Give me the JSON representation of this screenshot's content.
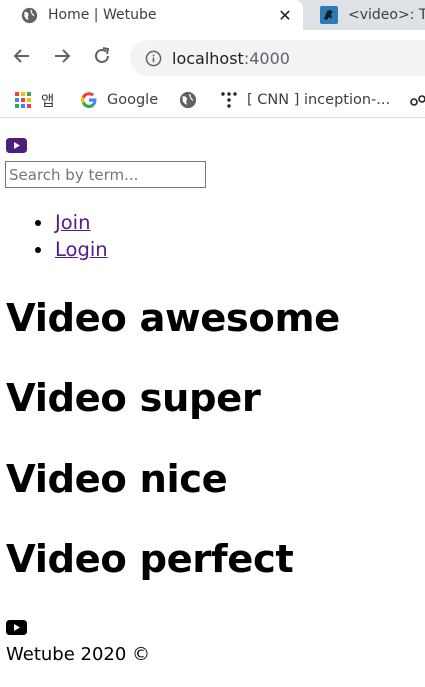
{
  "browser": {
    "tabs": [
      {
        "title": "Home | Wetube",
        "favicon": "globe-icon",
        "active": true,
        "close": "✕"
      },
      {
        "title": "<video>: Th",
        "favicon": "mdn-dino-icon",
        "active": false
      }
    ],
    "address": {
      "host": "localhost",
      "port": ":4000"
    },
    "bookmarks": [
      {
        "label": "앱",
        "icon": "apps-grid-icon"
      },
      {
        "label": "Google",
        "icon": "google-icon"
      },
      {
        "label": "",
        "icon": "globe-icon"
      },
      {
        "label": "[ CNN ] inception-...",
        "icon": "dots-icon"
      }
    ]
  },
  "header": {
    "logo_icon": "youtube-icon",
    "search_placeholder": "Search by term...",
    "nav": [
      {
        "label": "Join"
      },
      {
        "label": "Login"
      }
    ]
  },
  "videos": [
    {
      "title": "Video awesome"
    },
    {
      "title": "Video super"
    },
    {
      "title": "Video nice"
    },
    {
      "title": "Video perfect"
    }
  ],
  "footer": {
    "logo_icon": "youtube-icon",
    "text": "Wetube 2020 ©"
  },
  "colors": {
    "header_logo": "#4c1f7a",
    "footer_logo": "#000000",
    "link": "#551a8b"
  }
}
